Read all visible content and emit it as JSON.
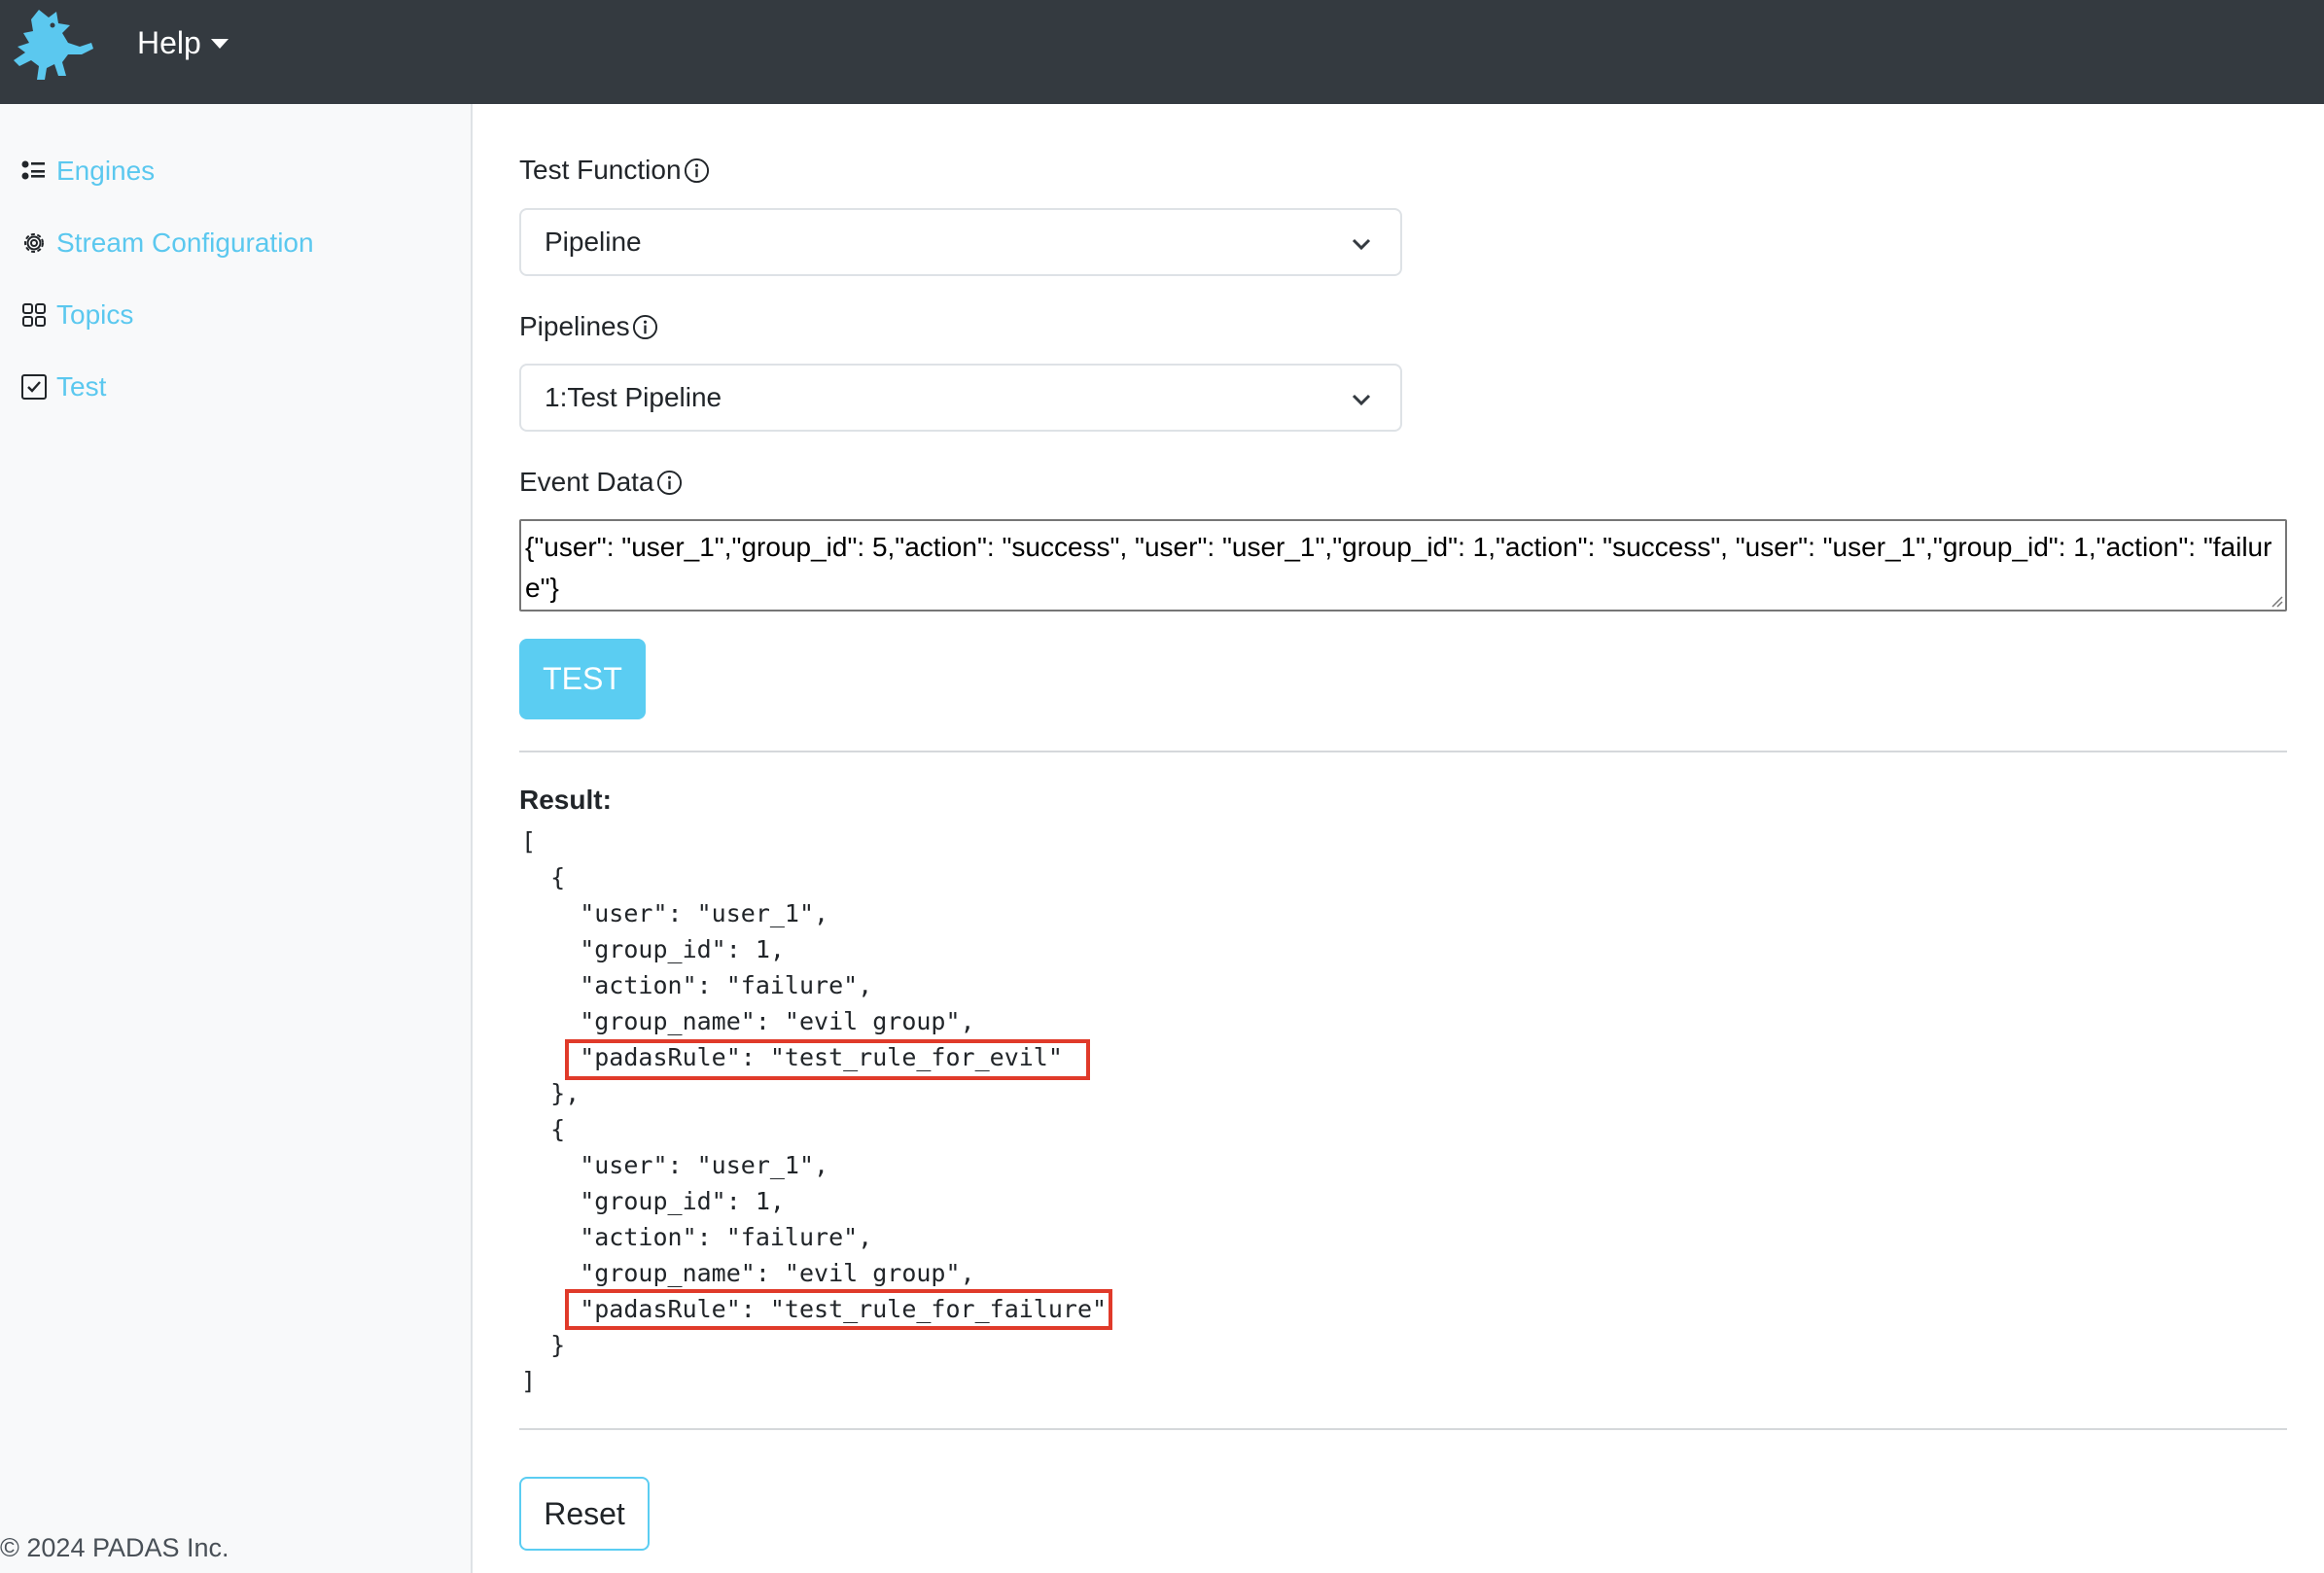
{
  "navbar": {
    "logo_icon": "dragon-logo-icon",
    "help_label": "Help"
  },
  "sidebar": {
    "items": [
      {
        "label": "Engines",
        "icon": "list-icon"
      },
      {
        "label": "Stream Configuration",
        "icon": "gear-icon"
      },
      {
        "label": "Topics",
        "icon": "grid-icon"
      },
      {
        "label": "Test",
        "icon": "check-square-icon"
      }
    ],
    "footer": "© 2024 PADAS Inc."
  },
  "form": {
    "test_function_label": "Test Function",
    "test_function_value": "Pipeline",
    "pipelines_label": "Pipelines",
    "pipelines_value": "1:Test Pipeline",
    "event_data_label": "Event Data",
    "event_data_value": "{\"user\": \"user_1\",\"group_id\": 5,\"action\": \"success\", \"user\": \"user_1\",\"group_id\": 1,\"action\": \"success\", \"user\": \"user_1\",\"group_id\": 1,\"action\": \"failure\"}",
    "test_button": "TEST"
  },
  "result": {
    "label": "Result:",
    "lines": [
      "[",
      "  {",
      "    \"user\": \"user_1\",",
      "    \"group_id\": 1,",
      "    \"action\": \"failure\",",
      "    \"group_name\": \"evil group\",",
      "    \"padasRule\": \"test_rule_for_evil\"",
      "  },",
      "  {",
      "    \"user\": \"user_1\",",
      "    \"group_id\": 1,",
      "    \"action\": \"failure\",",
      "    \"group_name\": \"evil group\",",
      "    \"padasRule\": \"test_rule_for_failure\"",
      "  }",
      "]"
    ]
  },
  "reset_button": "Reset",
  "colors": {
    "accent": "#5bcdf2",
    "navbar": "#343a40",
    "highlight": "#e03a2a"
  }
}
